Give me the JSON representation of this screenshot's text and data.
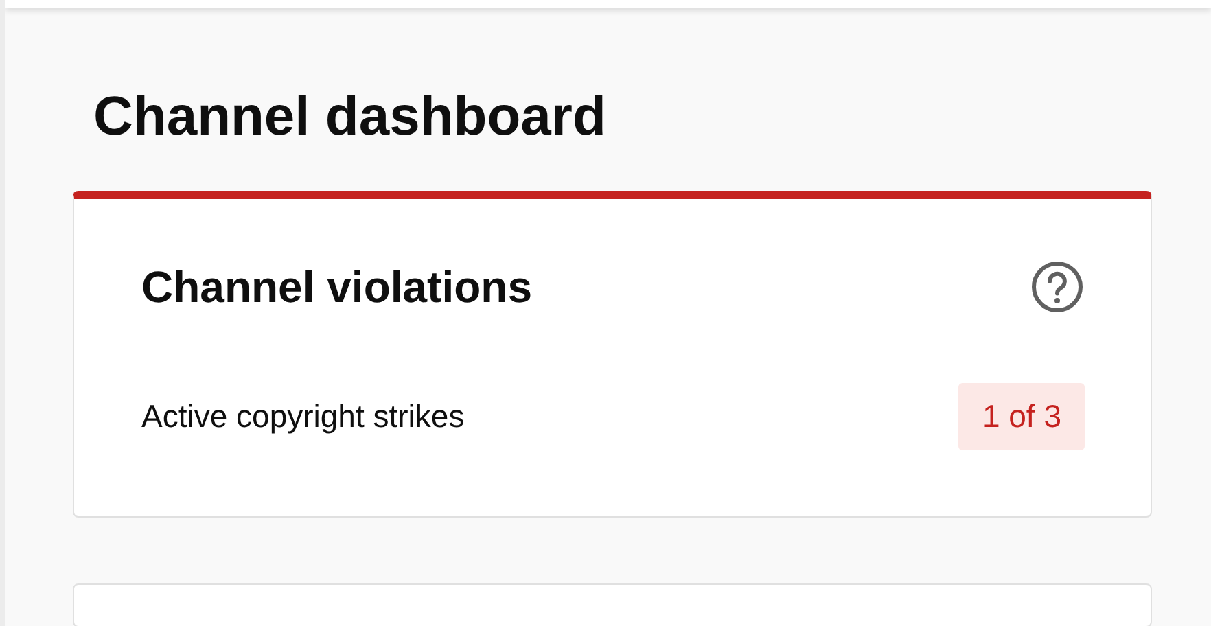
{
  "page": {
    "title": "Channel dashboard"
  },
  "violations_card": {
    "title": "Channel violations",
    "rows": [
      {
        "label": "Active copyright strikes",
        "badge": "1 of 3"
      }
    ]
  }
}
